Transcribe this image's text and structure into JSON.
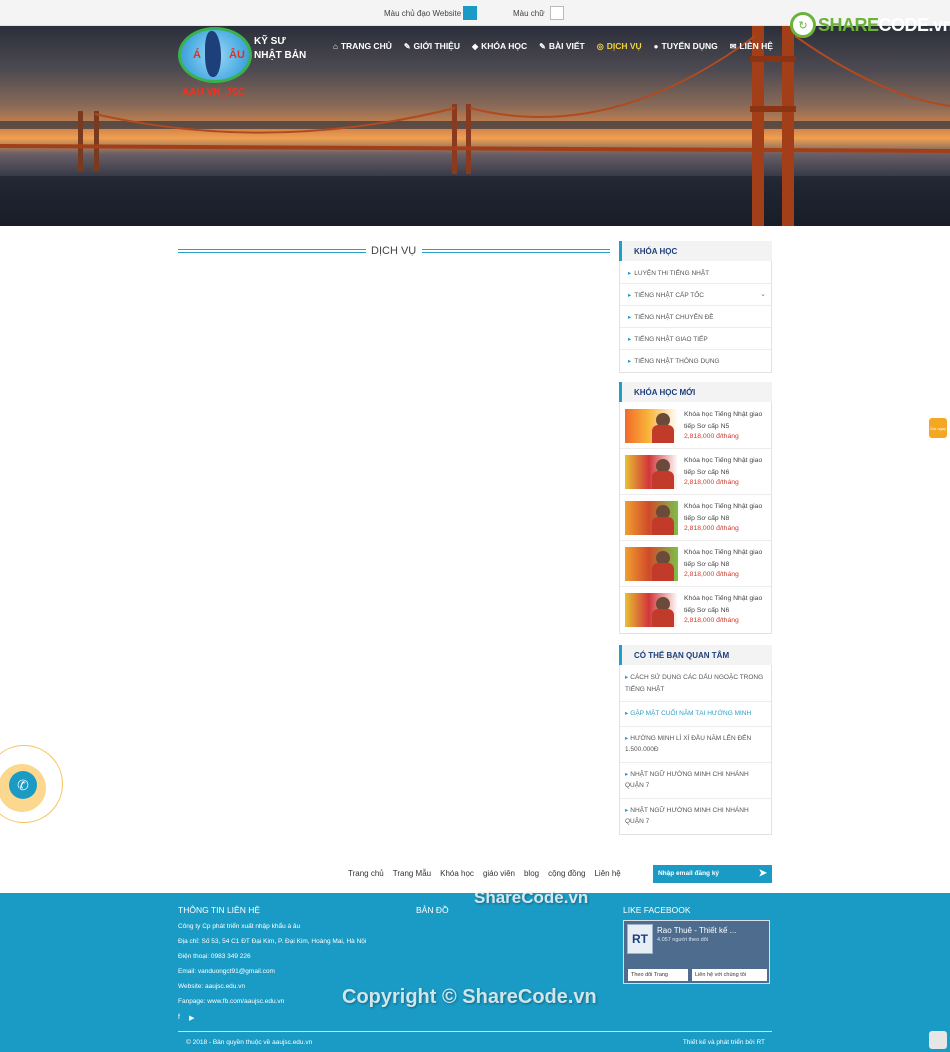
{
  "colorbar": {
    "main_color_label": "Màu chủ đạo Website",
    "text_color_label": "Màu chữ",
    "main_color": "#1a9bc5",
    "text_color": "#ffffff"
  },
  "header": {
    "logo_letters": [
      "Á",
      "ÂU"
    ],
    "logo_sub": "AAU VN_JSC",
    "brand_line1": "KỸ SƯ",
    "brand_line2": "NHẬT BẢN",
    "nav": [
      {
        "label": "TRANG CHỦ",
        "icon": "home-icon",
        "glyph": "⌂"
      },
      {
        "label": "GIỚI THIỆU",
        "icon": "edit-icon",
        "glyph": "✎"
      },
      {
        "label": "KHÓA HỌC",
        "icon": "tag-icon",
        "glyph": "◆"
      },
      {
        "label": "BÀI VIẾT",
        "icon": "edit-icon",
        "glyph": "✎"
      },
      {
        "label": "DỊCH VỤ",
        "icon": "instagram-icon",
        "glyph": "◎"
      },
      {
        "label": "TUYỂN DỤNG",
        "icon": "user-icon",
        "glyph": "●"
      },
      {
        "label": "LIÊN HỆ",
        "icon": "envelope-icon",
        "glyph": "✉"
      }
    ],
    "active_index": 4,
    "sharecode_pre": "SHARE",
    "sharecode_post": "CODE.vn"
  },
  "main": {
    "title": "DỊCH VỤ"
  },
  "sidebar": {
    "courses_title": "KHÓA HỌC",
    "courses": [
      {
        "label": "LUYỆN THI TIẾNG NHẬT",
        "has_children": false
      },
      {
        "label": "TIẾNG NHẬT CẤP TỐC",
        "has_children": true
      },
      {
        "label": "TIẾNG NHẬT CHUYÊN ĐỀ",
        "has_children": false
      },
      {
        "label": "TIẾNG NHẬT GIAO TIẾP",
        "has_children": false
      },
      {
        "label": "TIẾNG NHẬT THÔNG DỤNG",
        "has_children": false
      }
    ],
    "new_title": "KHÓA HỌC MỚI",
    "new_courses": [
      {
        "title": "Khóa học Tiếng Nhật giao tiếp Sơ cấp N5",
        "price": "2,818,000 đ/tháng"
      },
      {
        "title": "Khóa học Tiếng Nhật giao tiếp Sơ cấp N6",
        "price": "2,818,000 đ/tháng"
      },
      {
        "title": "Khóa học Tiếng Nhật giao tiếp Sơ cấp N8",
        "price": "2,818,000 đ/tháng"
      },
      {
        "title": "Khóa học Tiếng Nhật giao tiếp Sơ cấp N8",
        "price": "2,818,000 đ/tháng"
      },
      {
        "title": "Khóa học Tiếng Nhật giao tiếp Sơ cấp N6",
        "price": "2,818,000 đ/tháng"
      }
    ],
    "interest_title": "CÓ THỂ BẠN QUAN TÂM",
    "interests": [
      {
        "label": "CÁCH SỬ DỤNG CÁC DẤU NGOẶC TRONG TIẾNG NHẬT",
        "highlight": false
      },
      {
        "label": "GẶP MẶT CUỐI NĂM TẠI HƯỚNG MINH",
        "highlight": true
      },
      {
        "label": "HƯỚNG MINH LÌ XÌ ĐẦU NĂM LÊN ĐẾN 1.500.000Đ",
        "highlight": false
      },
      {
        "label": "NHẬT NGỮ HƯỚNG MINH CHI NHÁNH QUẬN 7",
        "highlight": false
      },
      {
        "label": "NHẬT NGỮ HƯỚNG MINH CHI NHÁNH QUẬN 7",
        "highlight": false
      }
    ]
  },
  "side_tab": "Gọi ngay",
  "bottom_nav": [
    "Trang chủ",
    "Trang Mẫu",
    "Khóa học",
    "giáo viên",
    "blog",
    "cộng đồng",
    "Liên hệ"
  ],
  "subscribe_placeholder": "Nhập email đăng ký",
  "footer": {
    "contact_title": "THÔNG TIN LIÊN HỆ",
    "map_title": "BẢN ĐỒ",
    "fb_title": "LIKE FACEBOOK",
    "lines": [
      "Công ty Cp phát triển xuất nhập khẩu á âu",
      "Địa chỉ: Số 53, 54 C1 ĐT Đại Kim, P. Đại Kim, Hoàng Mai, Hà Nội",
      "Điện thoại: 0983 349 226",
      "Email: vanduongct91@gmail.com",
      "Website: aaujsc.edu.vn",
      "Fanpage: www.fb.com/aaujsc.edu.vn"
    ],
    "fb_name": "Rao Thuê - Thiết kế ...",
    "fb_followers": "4.057 người theo dõi",
    "fb_follow_btn": "Theo dõi Trang",
    "fb_contact_btn": "Liên hệ với chúng tôi",
    "copyright": "© 2018 - Bản quyền thuộc về aaujsc.edu.vn",
    "credit": "Thiết kế và phát triển bởi RT"
  },
  "watermark_top": "ShareCode.vn",
  "watermark_copyright": "Copyright © ShareCode.vn"
}
